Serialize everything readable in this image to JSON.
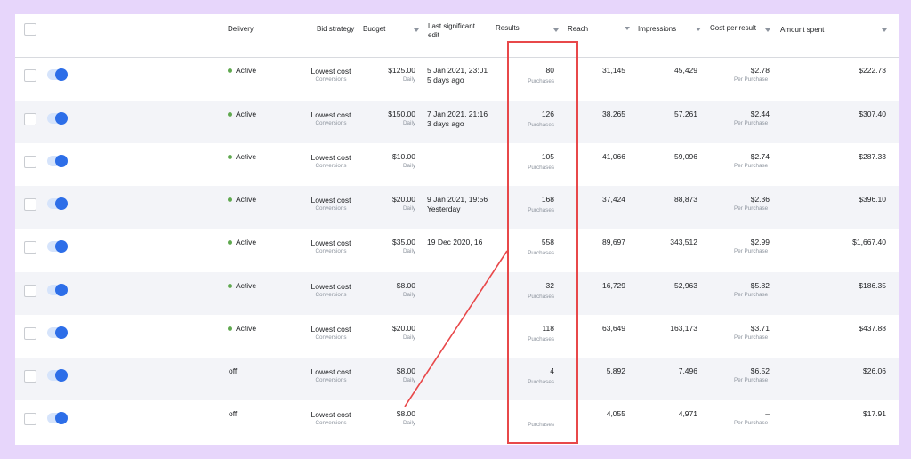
{
  "columns": {
    "delivery": "Delivery",
    "bid_strategy": "Bid strategy",
    "budget": "Budget",
    "last_edit": [
      "Last significant",
      "edit"
    ],
    "results": "Results",
    "reach": "Reach",
    "impressions": "Impressions",
    "cost_per_result": "Cost per result",
    "amount_spent": "Amount spent"
  },
  "rows": [
    {
      "delivery": "Active",
      "bid": "Lowest cost",
      "bid_sub": "Conversions",
      "budget": "$125.00",
      "budget_sub": "Daily",
      "edit1": "5 Jan 2021, 23:01",
      "edit2": "5 days ago",
      "results": "80",
      "results_sub": "Purchases",
      "reach": "31,145",
      "impressions": "45,429",
      "cpr": "$2.78",
      "cpr_sub": "Per Purchase",
      "spent": "$222.73"
    },
    {
      "delivery": "Active",
      "bid": "Lowest cost",
      "bid_sub": "Conversions",
      "budget": "$150.00",
      "budget_sub": "Daily",
      "edit1": "7 Jan 2021, 21:16",
      "edit2": "3 days ago",
      "results": "126",
      "results_sub": "Purchases",
      "reach": "38,265",
      "impressions": "57,261",
      "cpr": "$2.44",
      "cpr_sub": "Per Purchase",
      "spent": "$307.40"
    },
    {
      "delivery": "Active",
      "bid": "Lowest cost",
      "bid_sub": "Conversions",
      "budget": "$10.00",
      "budget_sub": "Daily",
      "edit1": "",
      "edit2": "",
      "results": "105",
      "results_sub": "Purchases",
      "reach": "41,066",
      "impressions": "59,096",
      "cpr": "$2.74",
      "cpr_sub": "Per Purchase",
      "spent": "$287.33"
    },
    {
      "delivery": "Active",
      "bid": "Lowest cost",
      "bid_sub": "Conversions",
      "budget": "$20.00",
      "budget_sub": "Daily",
      "edit1": "9 Jan 2021, 19:56",
      "edit2": "Yesterday",
      "results": "168",
      "results_sub": "Purchases",
      "reach": "37,424",
      "impressions": "88,873",
      "cpr": "$2.36",
      "cpr_sub": "Per Purchase",
      "spent": "$396.10"
    },
    {
      "delivery": "Active",
      "bid": "Lowest cost",
      "bid_sub": "Conversions",
      "budget": "$35.00",
      "budget_sub": "Daily",
      "edit1": "19 Dec 2020, 16",
      "edit2": "",
      "results": "558",
      "results_sub": "Purchases",
      "reach": "89,697",
      "impressions": "343,512",
      "cpr": "$2.99",
      "cpr_sub": "Per Purchase",
      "spent": "$1,667.40"
    },
    {
      "delivery": "Active",
      "bid": "Lowest cost",
      "bid_sub": "Conversions",
      "budget": "$8.00",
      "budget_sub": "Daily",
      "edit1": "",
      "edit2": "",
      "results": "32",
      "results_sub": "Purchases",
      "reach": "16,729",
      "impressions": "52,963",
      "cpr": "$5.82",
      "cpr_sub": "Per Purchase",
      "spent": "$186.35"
    },
    {
      "delivery": "Active",
      "bid": "Lowest cost",
      "bid_sub": "Conversions",
      "budget": "$20.00",
      "budget_sub": "Daily",
      "edit1": "",
      "edit2": "",
      "results": "118",
      "results_sub": "Purchases",
      "reach": "63,649",
      "impressions": "163,173",
      "cpr": "$3.71",
      "cpr_sub": "Per Purchase",
      "spent": "$437.88"
    },
    {
      "delivery": "off",
      "bid": "Lowest cost",
      "bid_sub": "Conversions",
      "budget": "$8.00",
      "budget_sub": "Daily",
      "edit1": "",
      "edit2": "",
      "results": "4",
      "results_sub": "Purchases",
      "reach": "5,892",
      "impressions": "7,496",
      "cpr": "$6,52",
      "cpr_sub": "Per Purchase",
      "spent": "$26.06"
    },
    {
      "delivery": "off",
      "bid": "Lowest cost",
      "bid_sub": "Conversions",
      "budget": "$8.00",
      "budget_sub": "Daily",
      "edit1": "",
      "edit2": "",
      "results": "",
      "results_sub": "Purchases",
      "reach": "4,055",
      "impressions": "4,971",
      "cpr": "–",
      "cpr_sub": "Per Purchase",
      "spent": "$17.91"
    }
  ],
  "colors": {
    "background": "#e7d6fb",
    "active_dot": "#5fa84f",
    "toggle_on": "#2d6ee8",
    "highlight": "#e8484a",
    "row_alt": "#f3f4f8"
  },
  "annotation": {
    "highlight_column": "results",
    "arrow": "from results column down to budget of last row"
  }
}
